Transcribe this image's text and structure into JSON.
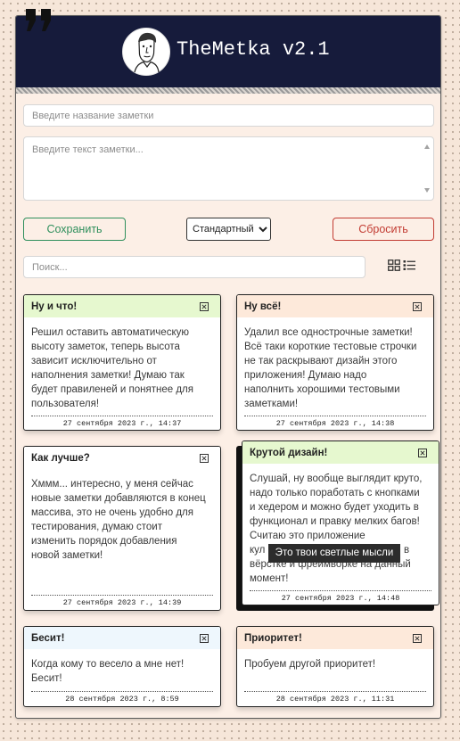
{
  "app": {
    "title": "TheMetka v2.1"
  },
  "theme": {
    "page_bg": "#f6e6d9",
    "panel_bg": "#fcefe6",
    "header_bg": "#161b3b",
    "save_color": "#2f8f5c",
    "reset_color": "#c23b32",
    "tooltip_bg": "#2c2c2c"
  },
  "icons": {
    "decor": "quote-icon",
    "avatar": "avatar",
    "view_grid": "grid-view-icon",
    "view_list": "list-view-icon",
    "note_close": "close-note-icon"
  },
  "form": {
    "title_placeholder": "Введите название заметки",
    "text_placeholder": "Введите текст заметки...",
    "save_label": "Сохранить",
    "priority_selected": "Стандартный",
    "reset_label": "Сбросить"
  },
  "search": {
    "placeholder": "Поиск..."
  },
  "notes": [
    {
      "title": "Ну и что!",
      "header_color": "#e6f8cf",
      "lines": [
        "Решил оставить автоматическую",
        "высоту заметок, теперь высота",
        "зависит исключительно от",
        "наполнения заметки! Думаю так",
        "будет правиленей и понятнее для",
        "пользователя!"
      ],
      "date": "27 сентября 2023 г., 14:37"
    },
    {
      "title": "Ну всё!",
      "header_color": "#fde9da",
      "lines": [
        "Удалил все однострочные заметки!",
        "Всё таки короткие тестовые строчки",
        "не так раскрывают дизайн этого",
        "приложения! Думаю надо",
        "наполнить хорошими тестовыми",
        "заметками!"
      ],
      "date": "27 сентября 2023 г., 14:38"
    },
    {
      "title": "Как лучше?",
      "header_color": "#ffffff",
      "lines": [
        "Хммм... интересно, у меня сейчас",
        "новые заметки добавляются в конец",
        "массива, это не очень удобно для",
        "тестирования, думаю стоит",
        "изменить порядок добавления",
        "новой заметки!"
      ],
      "date": "27 сентября 2023 г., 14:39"
    },
    {
      "title": "Крутой дизайн!",
      "header_color": "#e6f8cf",
      "hovered": true,
      "lines": [
        "Слушай, ну вообще выглядит круто,",
        "надо только поработать с кнопками",
        "и хедером и можно будет уходить в",
        "функционал и правку мелких багов!",
        "Считаю это приложение",
        {
          "start": "кул",
          "end": "в"
        },
        "вёрстке и фреймворке на данный",
        "момент!"
      ],
      "date": "27 сентября 2023 г., 14:48"
    },
    {
      "title": "Бесит!",
      "header_color": "#eef7fd",
      "lines": [
        "Когда кому то весело а мне нет!",
        "Бесит!"
      ],
      "date": "28 сентября 2023 г., 8:59"
    },
    {
      "title": "Приоритет!",
      "header_color": "#fde9da",
      "lines": [
        "Пробуем другой приоритет!"
      ],
      "date": "28 сентября 2023 г., 11:31"
    }
  ],
  "tooltip": {
    "text": "Это твои светлые мысли"
  }
}
